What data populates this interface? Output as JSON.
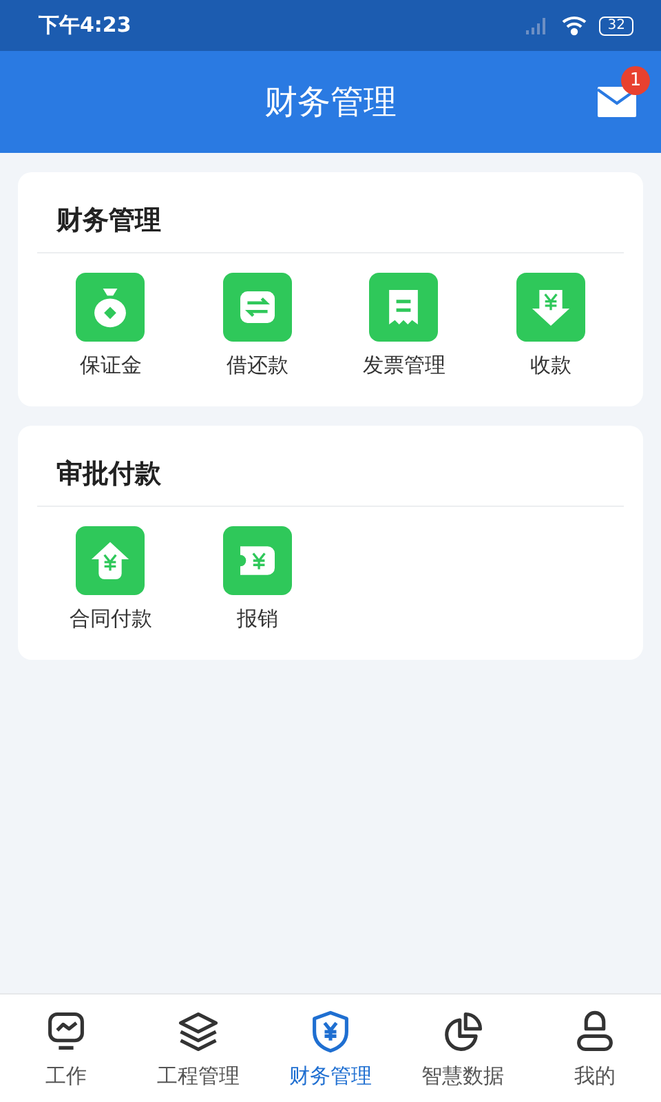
{
  "status_bar": {
    "time": "下午4:23",
    "battery": "32"
  },
  "header": {
    "title": "财务管理",
    "badge": "1"
  },
  "sections": [
    {
      "title": "财务管理",
      "items": [
        {
          "label": "保证金",
          "kind": "bag"
        },
        {
          "label": "借还款",
          "kind": "exchange"
        },
        {
          "label": "发票管理",
          "kind": "receipt"
        },
        {
          "label": "收款",
          "kind": "receive"
        }
      ]
    },
    {
      "title": "审批付款",
      "items": [
        {
          "label": "合同付款",
          "kind": "pay"
        },
        {
          "label": "报销",
          "kind": "ticket"
        }
      ]
    }
  ],
  "tabs": [
    {
      "label": "工作",
      "kind": "work",
      "selected": false
    },
    {
      "label": "工程管理",
      "kind": "layers",
      "selected": false
    },
    {
      "label": "财务管理",
      "kind": "finance",
      "selected": true
    },
    {
      "label": "智慧数据",
      "kind": "chart",
      "selected": false
    },
    {
      "label": "我的",
      "kind": "user",
      "selected": false
    }
  ]
}
